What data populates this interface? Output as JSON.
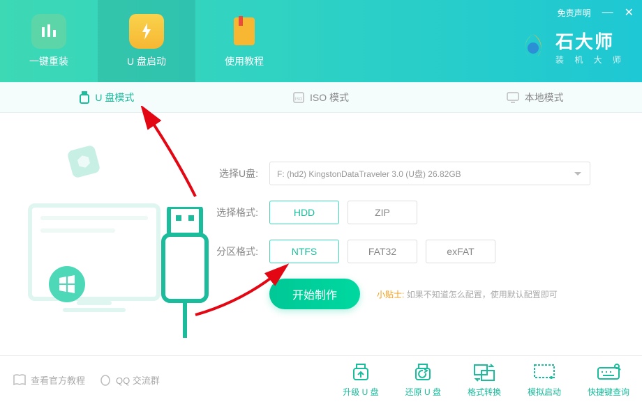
{
  "header": {
    "nav": [
      {
        "label": "一键重装"
      },
      {
        "label": "U 盘启动"
      },
      {
        "label": "使用教程"
      }
    ],
    "disclaimer": "免责声明",
    "logo_title": "石大师",
    "logo_sub": "装 机 大 师"
  },
  "modes": {
    "usb": "U 盘模式",
    "iso": "ISO 模式",
    "local": "本地模式"
  },
  "form": {
    "disk_label": "选择U盘:",
    "disk_value": "F: (hd2) KingstonDataTraveler 3.0 (U盘) 26.82GB",
    "format_label": "选择格式:",
    "formats": [
      "HDD",
      "ZIP"
    ],
    "partition_label": "分区格式:",
    "partitions": [
      "NTFS",
      "FAT32",
      "exFAT"
    ],
    "start": "开始制作",
    "tip_label": "小贴士:",
    "tip_text": "如果不知道怎么配置，使用默认配置即可"
  },
  "footer": {
    "left": {
      "official": "查看官方教程",
      "qq": "QQ 交流群"
    },
    "actions": {
      "upgrade": "升级 U 盘",
      "restore": "还原 U 盘",
      "convert": "格式转换",
      "simulate": "模拟启动",
      "shortcut": "快捷键查询"
    }
  }
}
